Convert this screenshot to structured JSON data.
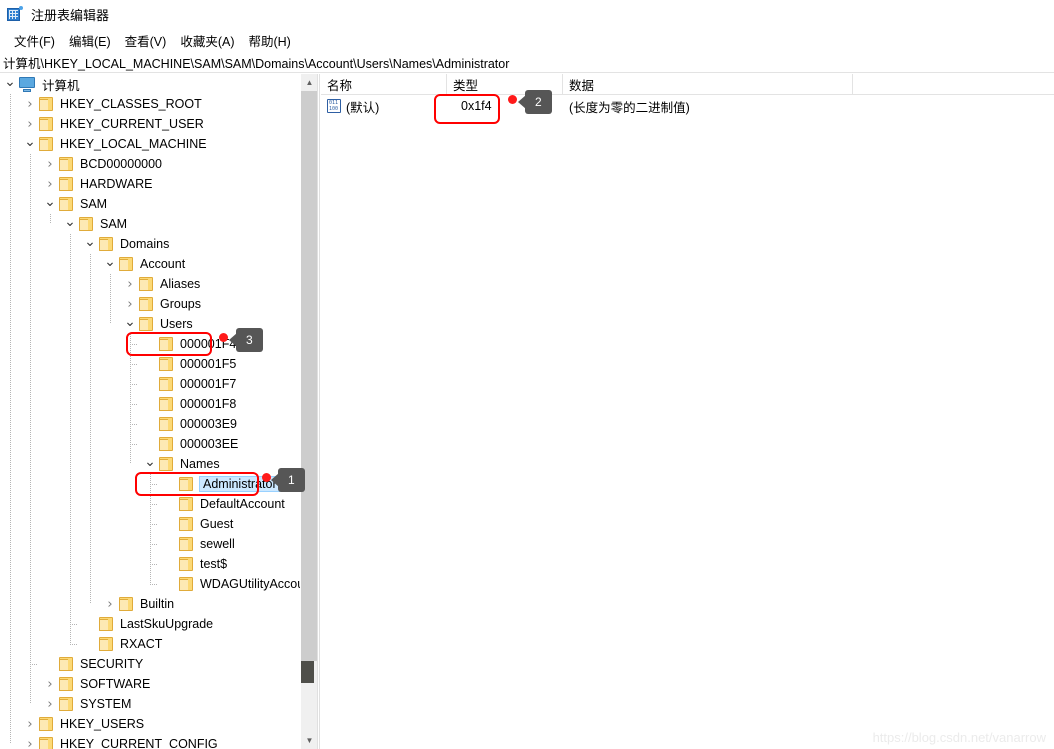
{
  "window": {
    "title": "注册表编辑器",
    "icon": "registry-editor-icon"
  },
  "menu": {
    "items": [
      {
        "label": "文件(F)"
      },
      {
        "label": "编辑(E)"
      },
      {
        "label": "查看(V)"
      },
      {
        "label": "收藏夹(A)"
      },
      {
        "label": "帮助(H)"
      }
    ]
  },
  "address": {
    "path": "计算机\\HKEY_LOCAL_MACHINE\\SAM\\SAM\\Domains\\Account\\Users\\Names\\Administrator"
  },
  "tree": {
    "nodes": [
      {
        "label": "计算机",
        "depth": 0,
        "twisty": "expanded",
        "icon": "computer-icon"
      },
      {
        "label": "HKEY_CLASSES_ROOT",
        "depth": 1,
        "twisty": "collapsed",
        "icon": "folder-icon"
      },
      {
        "label": "HKEY_CURRENT_USER",
        "depth": 1,
        "twisty": "collapsed",
        "icon": "folder-icon"
      },
      {
        "label": "HKEY_LOCAL_MACHINE",
        "depth": 1,
        "twisty": "expanded",
        "icon": "folder-icon"
      },
      {
        "label": "BCD00000000",
        "depth": 2,
        "twisty": "collapsed",
        "icon": "folder-icon"
      },
      {
        "label": "HARDWARE",
        "depth": 2,
        "twisty": "collapsed",
        "icon": "folder-icon"
      },
      {
        "label": "SAM",
        "depth": 2,
        "twisty": "expanded",
        "icon": "folder-icon"
      },
      {
        "label": "SAM",
        "depth": 3,
        "twisty": "expanded",
        "icon": "folder-icon"
      },
      {
        "label": "Domains",
        "depth": 4,
        "twisty": "expanded",
        "icon": "folder-icon"
      },
      {
        "label": "Account",
        "depth": 5,
        "twisty": "expanded",
        "icon": "folder-icon"
      },
      {
        "label": "Aliases",
        "depth": 6,
        "twisty": "collapsed",
        "icon": "folder-icon"
      },
      {
        "label": "Groups",
        "depth": 6,
        "twisty": "collapsed",
        "icon": "folder-icon"
      },
      {
        "label": "Users",
        "depth": 6,
        "twisty": "expanded",
        "icon": "folder-icon"
      },
      {
        "label": "000001F4",
        "depth": 7,
        "twisty": "none",
        "icon": "folder-icon"
      },
      {
        "label": "000001F5",
        "depth": 7,
        "twisty": "none",
        "icon": "folder-icon"
      },
      {
        "label": "000001F7",
        "depth": 7,
        "twisty": "none",
        "icon": "folder-icon"
      },
      {
        "label": "000001F8",
        "depth": 7,
        "twisty": "none",
        "icon": "folder-icon"
      },
      {
        "label": "000003E9",
        "depth": 7,
        "twisty": "none",
        "icon": "folder-icon"
      },
      {
        "label": "000003EE",
        "depth": 7,
        "twisty": "none",
        "icon": "folder-icon"
      },
      {
        "label": "Names",
        "depth": 7,
        "twisty": "expanded",
        "icon": "folder-icon"
      },
      {
        "label": "Administrator",
        "depth": 8,
        "twisty": "none",
        "icon": "folder-icon",
        "selected": true
      },
      {
        "label": "DefaultAccount",
        "depth": 8,
        "twisty": "none",
        "icon": "folder-icon"
      },
      {
        "label": "Guest",
        "depth": 8,
        "twisty": "none",
        "icon": "folder-icon"
      },
      {
        "label": "sewell",
        "depth": 8,
        "twisty": "none",
        "icon": "folder-icon"
      },
      {
        "label": "test$",
        "depth": 8,
        "twisty": "none",
        "icon": "folder-icon"
      },
      {
        "label": "WDAGUtilityAccount",
        "depth": 8,
        "twisty": "none",
        "icon": "folder-icon"
      },
      {
        "label": "Builtin",
        "depth": 5,
        "twisty": "collapsed",
        "icon": "folder-icon"
      },
      {
        "label": "LastSkuUpgrade",
        "depth": 4,
        "twisty": "none",
        "icon": "folder-icon"
      },
      {
        "label": "RXACT",
        "depth": 4,
        "twisty": "none",
        "icon": "folder-icon"
      },
      {
        "label": "SECURITY",
        "depth": 2,
        "twisty": "none",
        "icon": "folder-icon"
      },
      {
        "label": "SOFTWARE",
        "depth": 2,
        "twisty": "collapsed",
        "icon": "folder-icon"
      },
      {
        "label": "SYSTEM",
        "depth": 2,
        "twisty": "collapsed",
        "icon": "folder-icon"
      },
      {
        "label": "HKEY_USERS",
        "depth": 1,
        "twisty": "collapsed",
        "icon": "folder-icon"
      },
      {
        "label": "HKEY_CURRENT_CONFIG",
        "depth": 1,
        "twisty": "collapsed",
        "icon": "folder-icon"
      }
    ]
  },
  "list": {
    "columns": [
      {
        "label": "名称"
      },
      {
        "label": "类型"
      },
      {
        "label": "数据"
      }
    ],
    "rows": [
      {
        "name": "(默认)",
        "type": "0x1f4",
        "data": "(长度为零的二进制值)",
        "icon": "binary-value-icon"
      }
    ]
  },
  "annotations": {
    "callouts": [
      {
        "number": "1",
        "target": "Administrator"
      },
      {
        "number": "2",
        "target": "0x1f4"
      },
      {
        "number": "3",
        "target": "000001F4"
      }
    ],
    "accent_color": "#ff0000",
    "bubble_color": "#565656"
  },
  "watermark": {
    "text": "https://blog.csdn.net/vanarrow"
  },
  "scrollbar": {
    "up_arrow": "chevron-up-icon",
    "down_arrow": "chevron-down-icon"
  }
}
